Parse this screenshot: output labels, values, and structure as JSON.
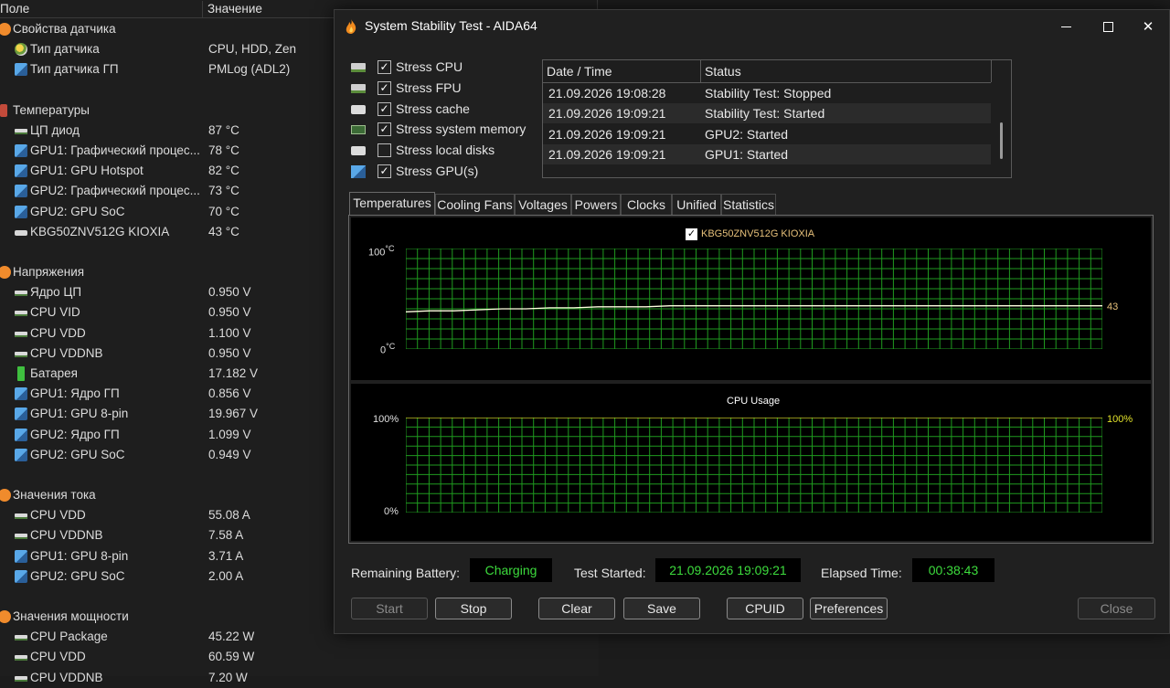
{
  "sensor_list": {
    "header": {
      "field": "Поле",
      "value": "Значение"
    },
    "rows": [
      {
        "kind": "group",
        "icon": "sensor-props-icon",
        "label": "Свойства датчика",
        "value": ""
      },
      {
        "kind": "item",
        "icon": "sensor-icon",
        "label": "Тип датчика",
        "value": "CPU, HDD, Zen"
      },
      {
        "kind": "item",
        "icon": "gpu-icon",
        "label": "Тип датчика ГП",
        "value": "PMLog  (ADL2)"
      },
      {
        "kind": "gap"
      },
      {
        "kind": "group",
        "icon": "thermometer-icon",
        "label": "Температуры",
        "value": ""
      },
      {
        "kind": "item",
        "icon": "chip-icon",
        "label": "ЦП диод",
        "value": "87 °C"
      },
      {
        "kind": "item",
        "icon": "gpu-icon",
        "label": "GPU1: Графический процес...",
        "value": "78 °C"
      },
      {
        "kind": "item",
        "icon": "gpu-icon",
        "label": "GPU1: GPU Hotspot",
        "value": "82 °C"
      },
      {
        "kind": "item",
        "icon": "gpu-icon",
        "label": "GPU2: Графический процес...",
        "value": "73 °C"
      },
      {
        "kind": "item",
        "icon": "gpu-icon",
        "label": "GPU2: GPU SoC",
        "value": "70 °C"
      },
      {
        "kind": "item",
        "icon": "disk-icon",
        "label": "KBG50ZNV512G KIOXIA",
        "value": "43 °C"
      },
      {
        "kind": "gap"
      },
      {
        "kind": "group",
        "icon": "voltage-icon",
        "label": "Напряжения",
        "value": ""
      },
      {
        "kind": "item",
        "icon": "chip-icon",
        "label": "Ядро ЦП",
        "value": "0.950 V"
      },
      {
        "kind": "item",
        "icon": "chip-icon",
        "label": "CPU VID",
        "value": "0.950 V"
      },
      {
        "kind": "item",
        "icon": "chip-icon",
        "label": "CPU VDD",
        "value": "1.100 V"
      },
      {
        "kind": "item",
        "icon": "chip-icon",
        "label": "CPU VDDNB",
        "value": "0.950 V"
      },
      {
        "kind": "item",
        "icon": "battery-icon",
        "label": "Батарея",
        "value": "17.182 V"
      },
      {
        "kind": "item",
        "icon": "gpu-icon",
        "label": "GPU1: Ядро ГП",
        "value": "0.856 V"
      },
      {
        "kind": "item",
        "icon": "gpu-icon",
        "label": "GPU1: GPU 8-pin",
        "value": "19.967 V"
      },
      {
        "kind": "item",
        "icon": "gpu-icon",
        "label": "GPU2: Ядро ГП",
        "value": "1.099 V"
      },
      {
        "kind": "item",
        "icon": "gpu-icon",
        "label": "GPU2: GPU SoC",
        "value": "0.949 V"
      },
      {
        "kind": "gap"
      },
      {
        "kind": "group",
        "icon": "current-icon",
        "label": "Значения тока",
        "value": ""
      },
      {
        "kind": "item",
        "icon": "chip-icon",
        "label": "CPU VDD",
        "value": "55.08 A"
      },
      {
        "kind": "item",
        "icon": "chip-icon",
        "label": "CPU VDDNB",
        "value": "7.58 A"
      },
      {
        "kind": "item",
        "icon": "gpu-icon",
        "label": "GPU1: GPU 8-pin",
        "value": "3.71 A"
      },
      {
        "kind": "item",
        "icon": "gpu-icon",
        "label": "GPU2: GPU SoC",
        "value": "2.00 A"
      },
      {
        "kind": "gap"
      },
      {
        "kind": "group",
        "icon": "power-icon",
        "label": "Значения мощности",
        "value": ""
      },
      {
        "kind": "item",
        "icon": "chip-icon",
        "label": "CPU Package",
        "value": "45.22 W"
      },
      {
        "kind": "item",
        "icon": "chip-icon",
        "label": "CPU VDD",
        "value": "60.59 W"
      },
      {
        "kind": "item",
        "icon": "chip-icon",
        "label": "CPU VDDNB",
        "value": "7.20 W"
      }
    ]
  },
  "dialog": {
    "title": "System Stability Test - AIDA64",
    "stress_options": [
      {
        "label": "Stress CPU",
        "checked": true,
        "icon": "cpu-icon"
      },
      {
        "label": "Stress FPU",
        "checked": true,
        "icon": "fpu-icon"
      },
      {
        "label": "Stress cache",
        "checked": true,
        "icon": "cache-icon"
      },
      {
        "label": "Stress system memory",
        "checked": true,
        "icon": "memory-icon"
      },
      {
        "label": "Stress local disks",
        "checked": false,
        "icon": "disk-icon"
      },
      {
        "label": "Stress GPU(s)",
        "checked": true,
        "icon": "gpu-icon"
      }
    ],
    "log": {
      "columns": {
        "date": "Date / Time",
        "status": "Status"
      },
      "rows": [
        {
          "date": "21.09.2026 19:08:28",
          "status": "Stability Test: Stopped"
        },
        {
          "date": "21.09.2026 19:09:21",
          "status": "Stability Test: Started"
        },
        {
          "date": "21.09.2026 19:09:21",
          "status": "GPU2: Started"
        },
        {
          "date": "21.09.2026 19:09:21",
          "status": "GPU1: Started"
        }
      ]
    },
    "tabs": [
      "Temperatures",
      "Cooling Fans",
      "Voltages",
      "Powers",
      "Clocks",
      "Unified",
      "Statistics"
    ],
    "active_tab": "Temperatures",
    "temp_graph": {
      "legend": "KBG50ZNV512G KIOXIA",
      "legend_checked": true,
      "y_top": "100",
      "y_bottom": "0",
      "unit": "°C",
      "current": "43",
      "line_color": "#ffffe0",
      "grid_color": "#1f9a1f"
    },
    "cpu_graph": {
      "title": "CPU Usage",
      "y_top": "100%",
      "y_bottom": "0%",
      "current": "100%",
      "current_color": "#e0e02a",
      "grid_color": "#1f9a1f"
    },
    "status": {
      "battery_label": "Remaining Battery:",
      "battery_value": "Charging",
      "started_label": "Test Started:",
      "started_value": "21.09.2026 19:09:21",
      "elapsed_label": "Elapsed Time:",
      "elapsed_value": "00:38:43",
      "value_color": "#3ddc3d"
    },
    "buttons": {
      "start": "Start",
      "stop": "Stop",
      "clear": "Clear",
      "save": "Save",
      "cpuid": "CPUID",
      "preferences": "Preferences",
      "close": "Close"
    }
  },
  "chart_data": [
    {
      "type": "line",
      "title": "",
      "series": [
        {
          "name": "KBG50ZNV512G KIOXIA",
          "values": [
            37,
            38,
            38,
            39,
            40,
            40,
            41,
            41,
            42,
            42,
            42,
            43,
            43,
            43,
            43,
            43,
            43,
            43,
            43,
            43,
            43,
            43,
            43,
            43,
            43,
            43,
            43,
            43,
            43,
            43
          ]
        }
      ],
      "ylabel": "°C",
      "ylim": [
        0,
        100
      ],
      "grid": true
    },
    {
      "type": "line",
      "title": "CPU Usage",
      "series": [
        {
          "values": [
            100,
            100,
            100,
            100,
            100,
            100,
            100,
            100,
            100,
            100
          ]
        }
      ],
      "ylim": [
        0,
        100
      ],
      "grid": true
    }
  ]
}
